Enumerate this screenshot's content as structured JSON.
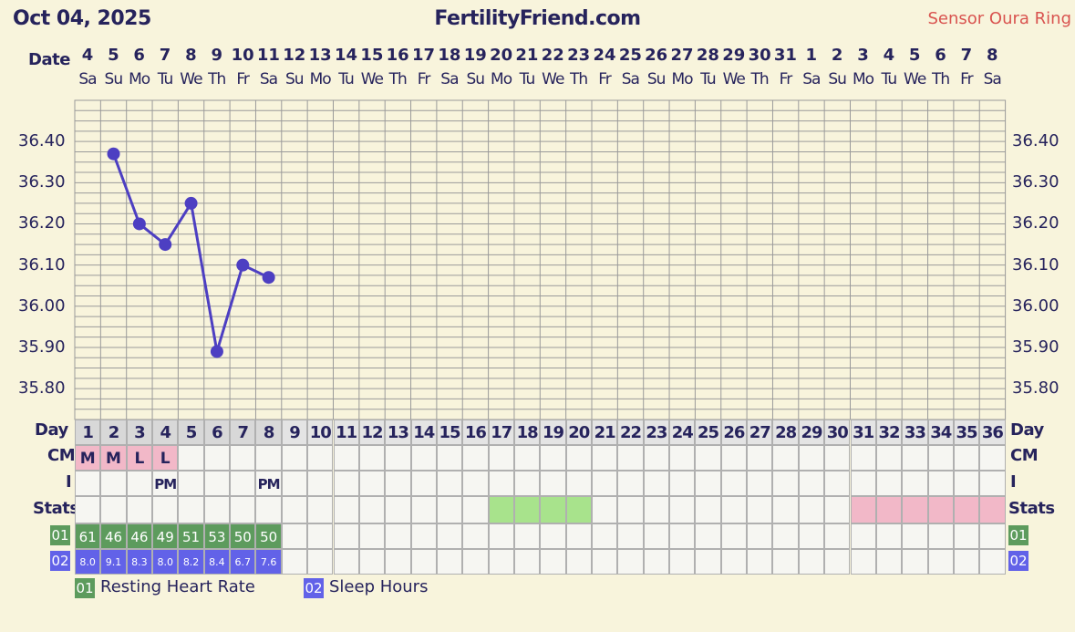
{
  "header": {
    "date": "Oct 04, 2025",
    "site": "FertilityFriend.com",
    "sensor": "Sensor Oura Ring"
  },
  "labels": {
    "date": "Date",
    "day": "Day",
    "cm": "CM",
    "intercourse": "I",
    "stats": "Stats"
  },
  "dates": [
    "4",
    "5",
    "6",
    "7",
    "8",
    "9",
    "10",
    "11",
    "12",
    "13",
    "14",
    "15",
    "16",
    "17",
    "18",
    "19",
    "20",
    "21",
    "22",
    "23",
    "24",
    "25",
    "26",
    "27",
    "28",
    "29",
    "30",
    "31",
    "1",
    "2",
    "3",
    "4",
    "5",
    "6",
    "7",
    "8"
  ],
  "weekdays": [
    "Sa",
    "Su",
    "Mo",
    "Tu",
    "We",
    "Th",
    "Fr",
    "Sa",
    "Su",
    "Mo",
    "Tu",
    "We",
    "Th",
    "Fr",
    "Sa",
    "Su",
    "Mo",
    "Tu",
    "We",
    "Th",
    "Fr",
    "Sa",
    "Su",
    "Mo",
    "Tu",
    "We",
    "Th",
    "Fr",
    "Sa",
    "Su",
    "Mo",
    "Tu",
    "We",
    "Th",
    "Fr",
    "Sa"
  ],
  "cycle_days": [
    "1",
    "2",
    "3",
    "4",
    "5",
    "6",
    "7",
    "8",
    "9",
    "10",
    "11",
    "12",
    "13",
    "14",
    "15",
    "16",
    "17",
    "18",
    "19",
    "20",
    "21",
    "22",
    "23",
    "24",
    "25",
    "26",
    "27",
    "28",
    "29",
    "30",
    "31",
    "32",
    "33",
    "34",
    "35",
    "36"
  ],
  "cm": [
    "M",
    "M",
    "L",
    "L"
  ],
  "intercourse": {
    "4": "PM",
    "8": "PM"
  },
  "stats": {
    "green_days": [
      17,
      18,
      19,
      20
    ],
    "pink_days": [
      31,
      32,
      33,
      34,
      35,
      36
    ],
    "colors": {
      "green": "#a8e38c",
      "pink": "#f2b8c8"
    }
  },
  "resting_heart_rate": {
    "badge": "01",
    "label": "Resting Heart Rate",
    "color": "#5d9b5d",
    "values": [
      "61",
      "46",
      "46",
      "49",
      "51",
      "53",
      "50",
      "50"
    ]
  },
  "sleep_hours": {
    "badge": "02",
    "label": "Sleep Hours",
    "color": "#6262e8",
    "values": [
      "8.0",
      "9.1",
      "8.3",
      "8.0",
      "8.2",
      "8.4",
      "6.7",
      "7.6"
    ]
  },
  "chart_data": {
    "type": "line",
    "x": [
      1,
      2,
      3,
      4,
      5,
      6,
      7,
      8
    ],
    "y": [
      36.37,
      36.2,
      36.15,
      36.25,
      35.89,
      36.1,
      36.07
    ],
    "x_days": [
      2,
      3,
      4,
      5,
      6,
      7,
      8
    ],
    "y_ticks": [
      "36.40",
      "36.30",
      "36.20",
      "36.10",
      "36.00",
      "35.90",
      "35.80"
    ],
    "ylim": [
      35.725,
      36.5
    ],
    "series_color": "#4d3fc2",
    "grid": true
  }
}
